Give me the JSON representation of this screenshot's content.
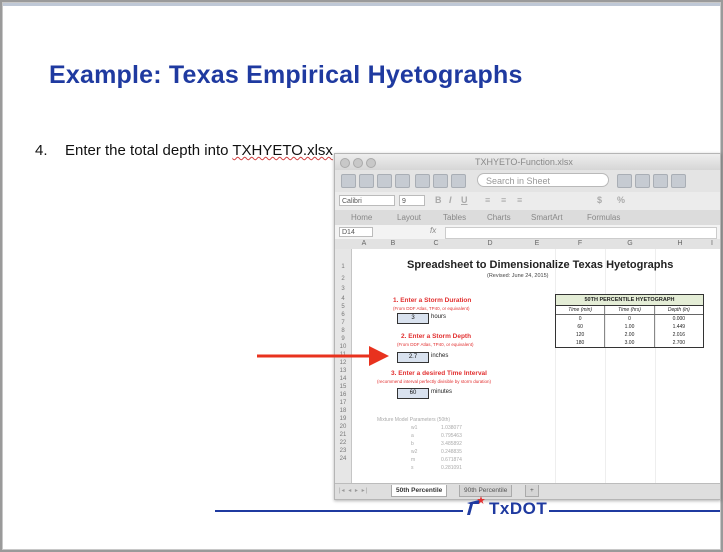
{
  "slide": {
    "title": "Example: Texas Empirical Hyetographs",
    "bullet_number": "4.",
    "bullet_text": "Enter the total depth into ",
    "bullet_filename": "TXHYETO.xlsx"
  },
  "excel": {
    "window_title": "TXHYETO-Function.xlsx",
    "search_placeholder": "Search in Sheet",
    "font_name": "Calibri",
    "font_size": "9",
    "ribbon_tabs": [
      "Home",
      "Layout",
      "Tables",
      "Charts",
      "SmartArt",
      "Formulas"
    ],
    "name_box": "D14",
    "fx_label": "fx",
    "columns": [
      "A",
      "B",
      "C",
      "D",
      "E",
      "F",
      "G",
      "H",
      "I"
    ],
    "rows": [
      "1",
      "2",
      "3",
      "4",
      "5",
      "6",
      "7",
      "8",
      "9",
      "10",
      "11",
      "12",
      "13",
      "14",
      "15",
      "16",
      "17",
      "18",
      "19",
      "20",
      "21",
      "22",
      "23",
      "24"
    ],
    "sheet_title": "Spreadsheet to Dimensionalize Texas Hyetographs",
    "sheet_subtitle": "(Revised: June 24, 2015)",
    "step1_label": "1. Enter a Storm Duration",
    "step1_note": "(From DDF Atlas, TP40, or equivalent)",
    "step1_value": "3",
    "step1_unit": "hours",
    "step2_label": "2. Enter a Storm Depth",
    "step2_note": "(From DDF Atlas, TP40, or equivalent)",
    "step2_value": "2.7",
    "step2_unit": "inches",
    "step3_label": "3. Enter a desired Time Interval",
    "step3_note": "(recommend interval perfectly divisible by storm duration)",
    "step3_value": "60",
    "step3_unit": "minutes",
    "params_title": "Mixture Model Parameters (50th)",
    "params": [
      {
        "name": "w1",
        "value": "1.038077"
      },
      {
        "name": "a",
        "value": "0.795463"
      },
      {
        "name": "b",
        "value": "3.485892"
      },
      {
        "name": "w2",
        "value": "0.248835"
      },
      {
        "name": "m",
        "value": "0.671874"
      },
      {
        "name": "s",
        "value": "0.281091"
      }
    ],
    "table": {
      "title": "50TH PERCENTILE HYETOGRAPH",
      "columns": [
        "Time (min)",
        "Time (hrs)",
        "Depth (in)"
      ],
      "rows": [
        [
          "0",
          "0",
          "0.000"
        ],
        [
          "60",
          "1.00",
          "1.449"
        ],
        [
          "120",
          "2.00",
          "2.016"
        ],
        [
          "180",
          "3.00",
          "2.700"
        ]
      ]
    },
    "sheet_tabs": {
      "active": "50th Percentile",
      "inactive": "90th Percentile",
      "add": "+"
    }
  },
  "footer": {
    "brand": "TxDOT",
    "line_color": "#1f3aa0"
  },
  "colors": {
    "title": "#1f3aa0",
    "arrow": "#e8321e",
    "highlight_red": "#e23030"
  }
}
